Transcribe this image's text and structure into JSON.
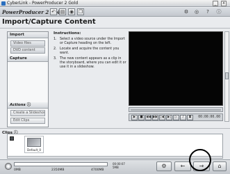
{
  "titlebar": {
    "title": "CyberLink - PowerProducer 2 Gold",
    "minimize": "_",
    "close": "x"
  },
  "toolbar": {
    "brand": "PowerProducer 2 Gold",
    "icons": [
      "back-icon",
      "film-icon",
      "disc-icon",
      "copy-icon"
    ],
    "right_icons": [
      "settings-icon",
      "burn-icon",
      "help-icon",
      "info-icon"
    ]
  },
  "heading": "Import/Capture Content",
  "left_panel": {
    "import_header": "Import",
    "import_items": [
      "Video files",
      "DVD content"
    ],
    "capture_header": "Capture",
    "actions_header": "Actions",
    "action_items": [
      "Create a Slideshow",
      "Edit Clips"
    ]
  },
  "instructions": {
    "title": "Instructions:",
    "steps": [
      {
        "num": "1.",
        "text": "Select a video source under the Import or Capture heading on the left."
      },
      {
        "num": "2.",
        "text": "Locate and acquire the content you want."
      },
      {
        "num": "3.",
        "text": "The new content appears as a clip in the storyboard, where you can edit it or use it in a slideshow."
      }
    ]
  },
  "player": {
    "controls": [
      "play",
      "stop",
      "rewind",
      "ffwd",
      "prev",
      "next",
      "step",
      "volume",
      "snapshot"
    ],
    "timecode": "00:00:00.00"
  },
  "clips": {
    "label": "Clips",
    "items": [
      {
        "caption": "Default_0"
      }
    ]
  },
  "bottom": {
    "disc_labels": [
      "0MB",
      "2350MB",
      "4700MB"
    ],
    "disc_fill_fraction": 0.0,
    "disc_time": [
      "00:00:07",
      "5MB"
    ],
    "buttons": {
      "settings": "settings-icon",
      "back": "back-arrow-icon",
      "next": "next-arrow-icon",
      "home": "home-icon"
    }
  }
}
